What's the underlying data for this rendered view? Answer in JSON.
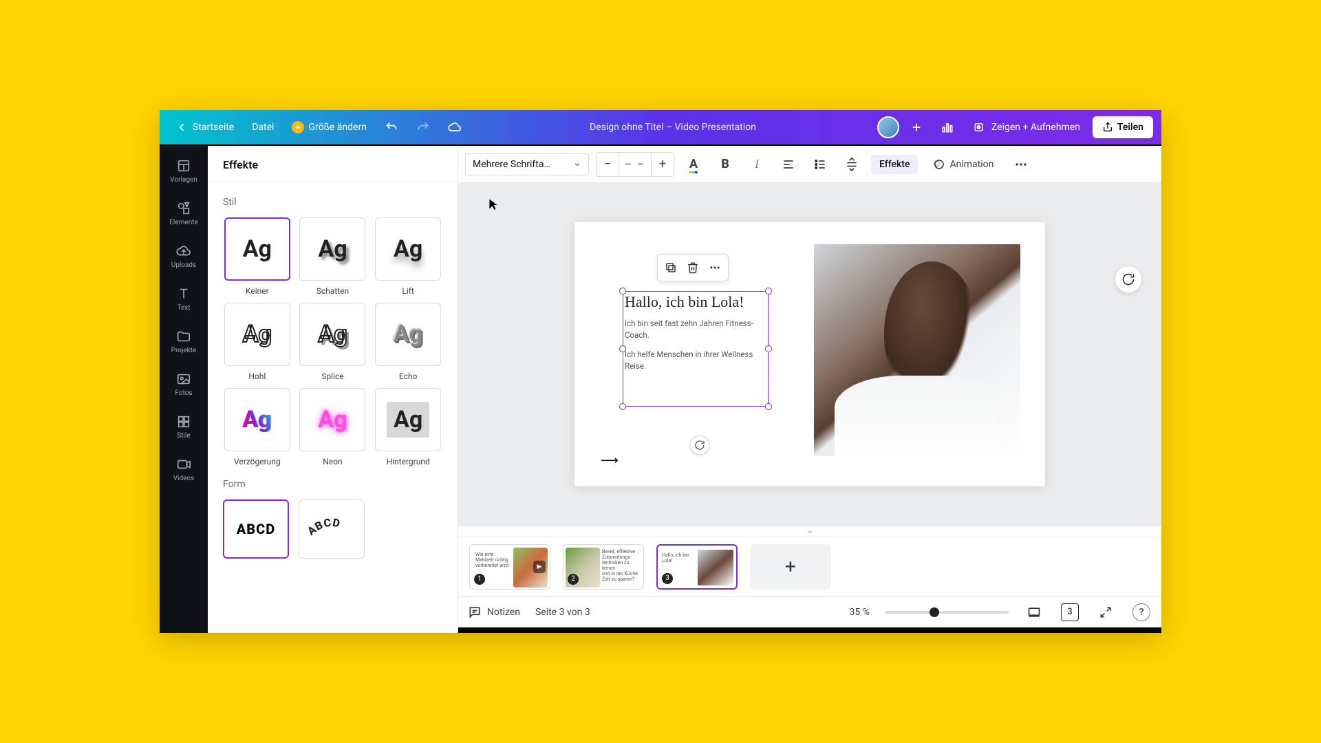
{
  "topbar": {
    "home": "Startseite",
    "file": "Datei",
    "resize": "Größe ändern",
    "title": "Design ohne Titel – Video Presentation",
    "present": "Zeigen + Aufnehmen",
    "share": "Teilen"
  },
  "nav": {
    "templates": "Vorlagen",
    "elements": "Elemente",
    "uploads": "Uploads",
    "text": "Text",
    "projects": "Projekte",
    "photos": "Fotos",
    "styles": "Stile",
    "videos": "Videos"
  },
  "panel": {
    "title": "Effekte",
    "style_section": "Stil",
    "form_section": "Form",
    "styles": {
      "none": "Keiner",
      "shadow": "Schatten",
      "lift": "Lift",
      "hollow": "Hohl",
      "splice": "Splice",
      "echo": "Echo",
      "glitch": "Verzögerung",
      "neon": "Neon",
      "background": "Hintergrund"
    },
    "sample": "Ag",
    "form_sample": "ABCD"
  },
  "ctx": {
    "font": "Mehrere Schrifta…",
    "size": "– –",
    "effects": "Effekte",
    "animation": "Animation"
  },
  "canvas": {
    "title": "Hallo, ich bin Lola!",
    "p1": "Ich bin seit fast zehn Jahren Fitness-Coach.",
    "p2": "Ich helfe Menschen in ihrer Wellness Reise.",
    "arrow": "⟶"
  },
  "thumbs": {
    "t1_line1": "Wie eine",
    "t1_line2": "Mahlzeit richtig",
    "t1_line3": "vorbereitet wird",
    "t2_line1": "Bereit, effektive",
    "t2_line2": "Zubereitungs-",
    "t2_line3": "techniken zu lernen",
    "t2_line4": "und in der Küche",
    "t2_line5": "Zeit zu sparen?",
    "t3_line1": "Hallo, ich bin Lola!",
    "page1": "1",
    "page2": "2",
    "page3": "3"
  },
  "status": {
    "notes": "Notizen",
    "page": "Seite 3 von 3",
    "zoom": "35 %",
    "page_badge": "3"
  }
}
